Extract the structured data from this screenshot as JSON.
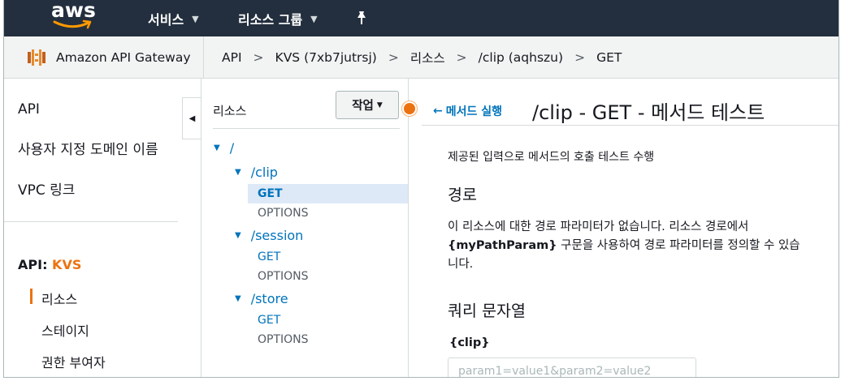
{
  "topnav": {
    "logo_text": "aws",
    "services_label": "서비스",
    "resource_groups_label": "리소스 그룹",
    "caret_icon": "chevron-down-icon",
    "pin_icon": "pin-icon"
  },
  "breadcrumb_bar": {
    "service_name": "Amazon API Gateway",
    "crumbs": [
      "API",
      "KVS (7xb7jutrsj)",
      "리소스",
      "/clip (aqhszu)",
      "GET"
    ],
    "separator": ">"
  },
  "leftnav": {
    "items": [
      "API",
      "사용자 지정 도메인 이름",
      "VPC 링크"
    ],
    "api_prefix": "API:",
    "api_name": "KVS",
    "sub_items": [
      "리소스",
      "스테이지",
      "권한 부여자"
    ],
    "collapse_glyph": "◀"
  },
  "tree": {
    "title": "리소스",
    "actions_label": "작업",
    "root": "/",
    "resources": [
      {
        "path": "/clip",
        "methods": [
          "GET",
          "OPTIONS"
        ]
      },
      {
        "path": "/session",
        "methods": [
          "GET",
          "OPTIONS"
        ]
      },
      {
        "path": "/store",
        "methods": [
          "GET",
          "OPTIONS"
        ]
      }
    ]
  },
  "main": {
    "back_label": "메서드 실행",
    "title": "/clip - GET - 메서드 테스트",
    "intro": "제공된 입력으로 메서드의 호출 테스트 수행",
    "path_heading": "경로",
    "path_desc_1": "이 리소스에 대한 경로 파라미터가 없습니다. 리소스 경로에서",
    "path_desc_param": "{myPathParam}",
    "path_desc_2": " 구문을 사용하여 경로 파라미터를 정의할 수 있습니다.",
    "query_heading": "쿼리 문자열",
    "clip_label": "{clip}",
    "clip_placeholder": "param1=value1&param2=value2",
    "clip_value": ""
  },
  "colors": {
    "nav_bg": "#232f3e",
    "accent_orange": "#ec7211",
    "link_blue": "#0073bb",
    "selected_row": "#dde9f7"
  }
}
